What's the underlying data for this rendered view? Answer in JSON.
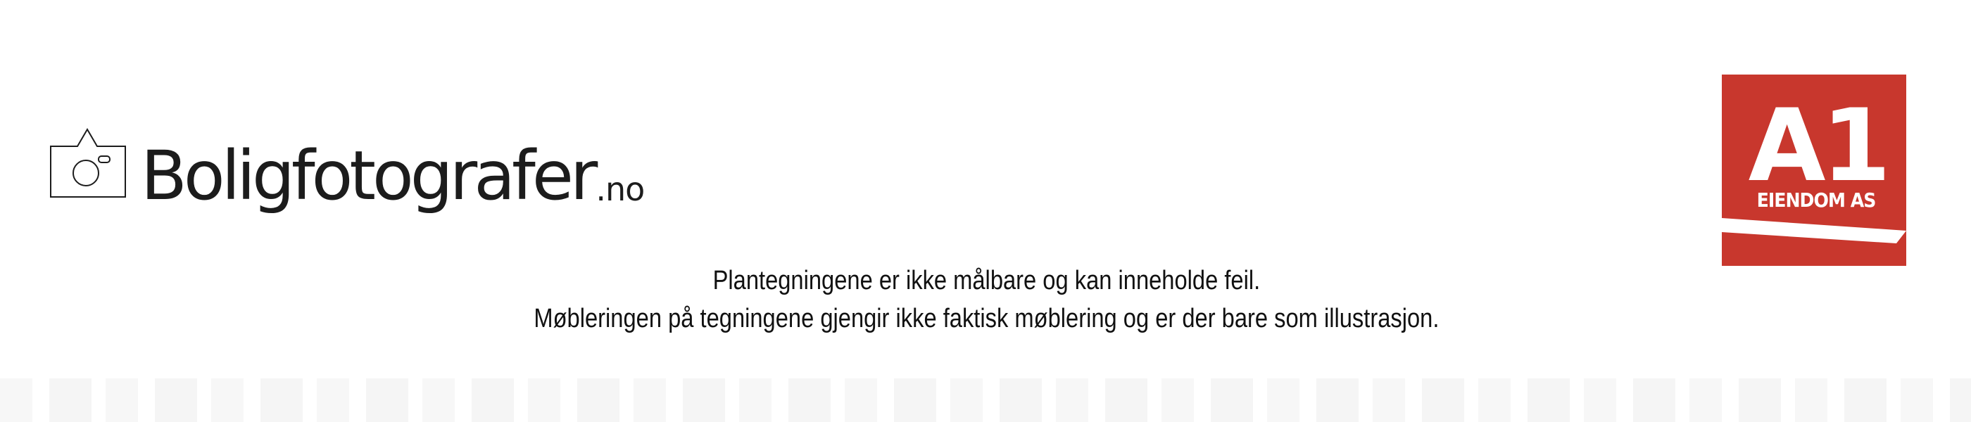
{
  "logo_left": {
    "wordmark": "Boligfotografer",
    "tld": ".no",
    "icon": "camera-house-icon"
  },
  "logo_right": {
    "mark": "A1",
    "subtitle": "EIENDOM AS",
    "color": "#c8372d",
    "icon": "a1-eiendom-logo"
  },
  "disclaimer": {
    "line1": "Plantegningene er ikke målbare og kan inneholde feil.",
    "line2": "Møbleringen på tegningene gjengir ikke faktisk møblering og er der bare som illustrasjon."
  }
}
